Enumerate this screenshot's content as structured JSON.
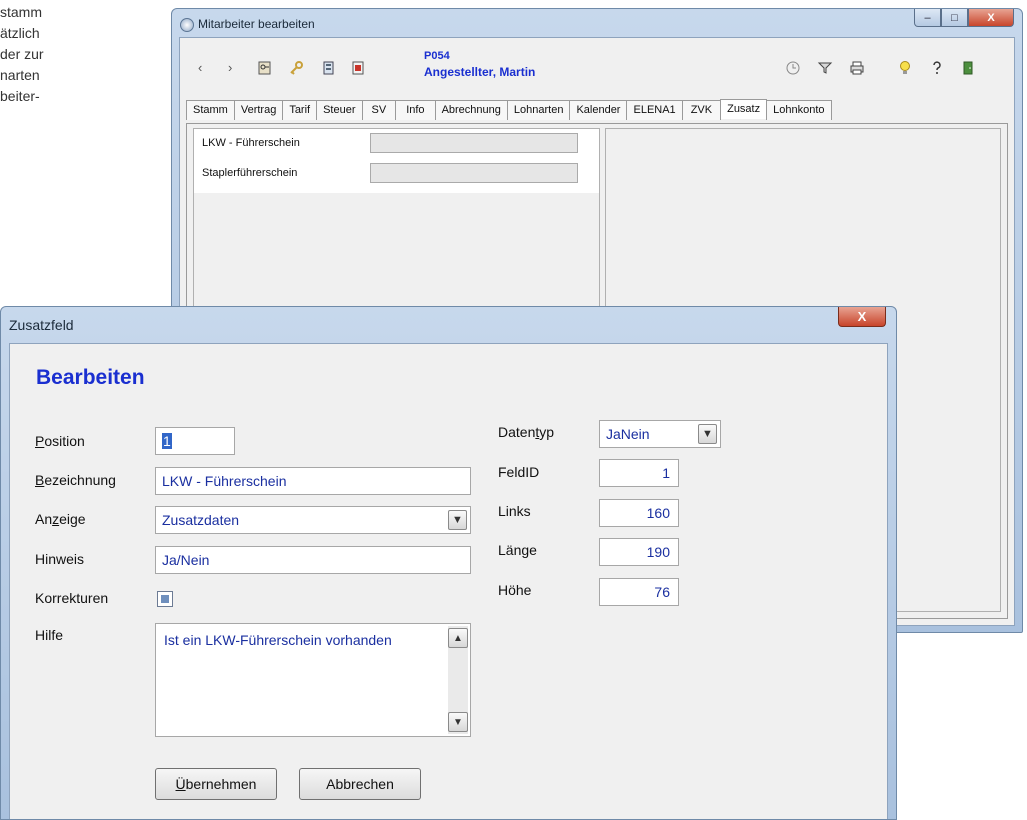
{
  "background_text": [
    "stamm",
    "ätzlich",
    "der zur",
    "narten",
    "beiter-"
  ],
  "back_window": {
    "title": "Mitarbeiter bearbeiten",
    "caption_buttons": [
      "–",
      "□",
      "X"
    ],
    "toolbar_icons": [
      "back-arrow-icon",
      "forward-arrow-icon",
      "key-list-icon",
      "key-icon",
      "document-icon",
      "pdf-icon",
      "clock-icon",
      "filter-icon",
      "print-icon",
      "bulb-icon",
      "help-icon",
      "exit-door-icon"
    ],
    "person_id": "P054",
    "person_name": "Angestellter, Martin",
    "tabs": [
      "Stamm",
      "Vertrag",
      "Tarif",
      "Steuer",
      "SV",
      "Info",
      "Abrechnung",
      "Lohnarten",
      "Kalender",
      "ELENA1",
      "ZVK",
      "Zusatz",
      "Lohnkonto"
    ],
    "active_tab": "Zusatz",
    "fields": [
      {
        "label": "LKW - Führerschein"
      },
      {
        "label": "Staplerführerschein"
      }
    ]
  },
  "dialog": {
    "title": "Zusatzfeld",
    "close_label": "X",
    "heading": "Bearbeiten",
    "labels": {
      "position": {
        "pre": "",
        "u": "P",
        "post": "osition"
      },
      "bezeichnung": {
        "pre": "",
        "u": "B",
        "post": "ezeichnung"
      },
      "anzeige": {
        "pre": "An",
        "u": "z",
        "post": "eige"
      },
      "hinweis": "Hinweis",
      "korrekturen": "Korrekturen",
      "hilfe": "Hilfe",
      "datentyp": {
        "pre": "Daten",
        "u": "t",
        "post": "yp"
      },
      "feldid": "FeldID",
      "links": "Links",
      "laenge": "Länge",
      "hoehe": "Höhe"
    },
    "values": {
      "position": "1",
      "bezeichnung": "LKW - Führerschein",
      "anzeige": "Zusatzdaten",
      "hinweis": "Ja/Nein",
      "korrekturen_checked": true,
      "hilfe": "Ist ein LKW-Führerschein vorhanden",
      "datentyp": "JaNein",
      "feldid": "1",
      "links": "160",
      "laenge": "190",
      "hoehe": "76"
    },
    "buttons": {
      "apply": {
        "pre": "",
        "u": "Ü",
        "post": "bernehmen"
      },
      "cancel": "Abbrechen"
    },
    "glyphs": {
      "dropdown": "▼",
      "scroll_up": "▲",
      "scroll_down": "▼"
    }
  }
}
